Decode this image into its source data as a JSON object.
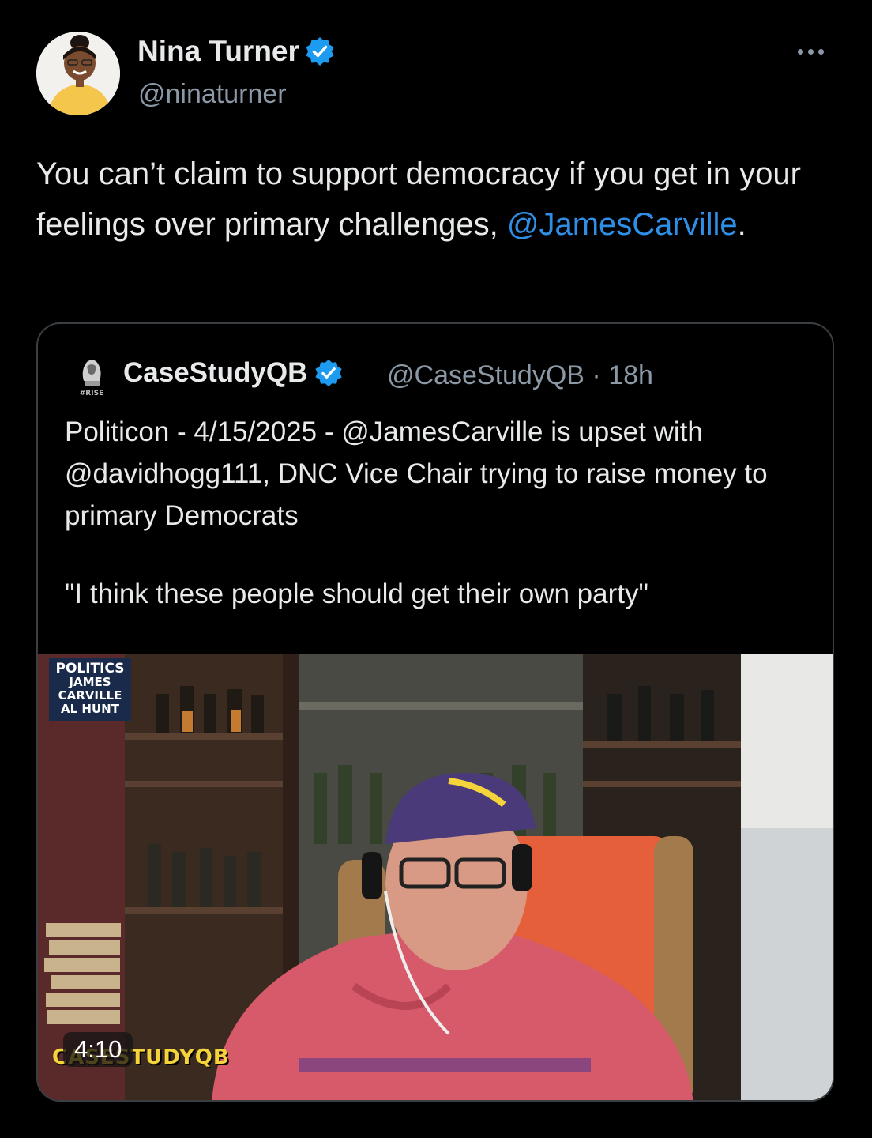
{
  "tweet": {
    "author_name": "Nina Turner",
    "author_handle": "@ninaturner",
    "text_part1": "You can’t claim to support democracy if you get in your feelings over primary challenges, ",
    "mention": "@JamesCarville",
    "text_end": ".",
    "more_icon": "more-horizontal-icon",
    "verified_color": "#1d9bf0"
  },
  "quoted": {
    "author_name": "CaseStudyQB",
    "author_handle": "@CaseStudyQB",
    "separator": "·",
    "time": "18h",
    "text": "Politicon - 4/15/2025 - @JamesCarville is upset with @davidhogg111, DNC Vice Chair trying to raise money to primary Democrats",
    "quote_line": "\"I think these people should get their own party\"",
    "avatar_tag": "#RISE",
    "video": {
      "duration": "4:10",
      "overlay_label": [
        "POLITICS",
        "JAMES",
        "CARVILLE",
        "AL HUNT"
      ],
      "watermark": "CASESTUDYQB"
    }
  }
}
